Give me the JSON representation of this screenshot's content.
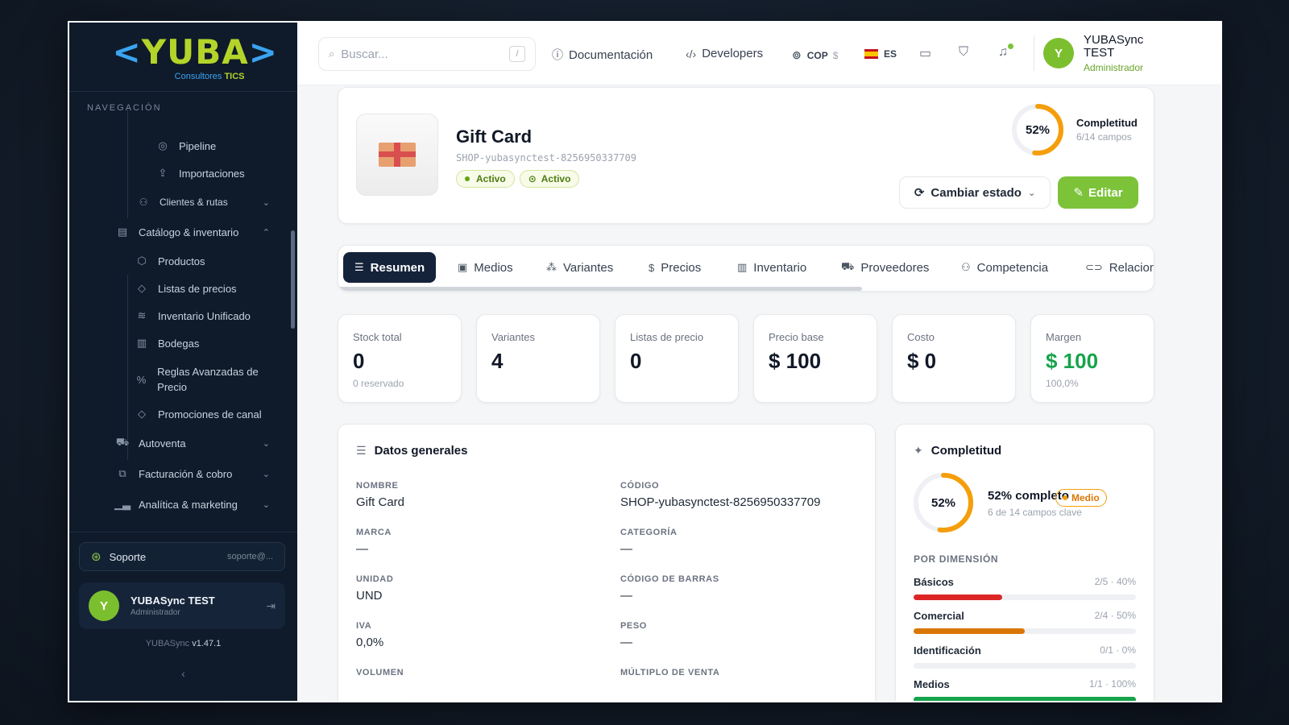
{
  "sidebar": {
    "logo": {
      "brand_left": "<",
      "brand_main": "YUBA",
      "brand_right": ">",
      "sub": "Consultores",
      "sub_bold": "TICS"
    },
    "nav_label": "NAVEGACIÓN",
    "items": [
      {
        "label": "Pipeline",
        "icon": "target-icon"
      },
      {
        "label": "Importaciones",
        "icon": "upload-icon"
      },
      {
        "label": "Clientes & rutas",
        "icon": "users-icon"
      },
      {
        "label": "Catálogo & inventario",
        "icon": "clipboard-icon"
      },
      {
        "label": "Productos",
        "icon": "cube-icon"
      },
      {
        "label": "Listas de precios",
        "icon": "tag-icon"
      },
      {
        "label": "Inventario Unificado",
        "icon": "layers-icon"
      },
      {
        "label": "Bodegas",
        "icon": "warehouse-icon"
      },
      {
        "label": "Reglas Avanzadas de Precio",
        "icon": "percent-icon"
      },
      {
        "label": "Promociones de canal",
        "icon": "tag-icon"
      },
      {
        "label": "Autoventa",
        "icon": "truck-icon"
      },
      {
        "label": "Facturación & cobro",
        "icon": "receipt-icon"
      },
      {
        "label": "Analítica & marketing",
        "icon": "chart-icon"
      }
    ],
    "support": {
      "label": "Soporte",
      "email": "soporte@..."
    },
    "user": {
      "initial": "Y",
      "name": "YUBASync TEST",
      "role": "Administrador"
    },
    "version_prefix": "YUBASync",
    "version": "v1.47.1"
  },
  "topbar": {
    "search": {
      "placeholder": "Buscar...",
      "shortcut": "/"
    },
    "docs": "Documentación",
    "developers": "Developers",
    "currency": "COP",
    "currency_symbol": "$",
    "language": "ES",
    "user": {
      "initial": "Y",
      "name": "YUBASync TEST",
      "role": "Administrador"
    }
  },
  "product": {
    "title": "Gift Card",
    "code": "SHOP-yubasynctest-8256950337709",
    "badges": [
      "Activo",
      "Activo"
    ],
    "completion": {
      "percent": 52,
      "percent_label": "52%",
      "label": "Completitud",
      "sub": "6/14 campos"
    },
    "change_state": "Cambiar estado",
    "edit": "Editar"
  },
  "tabs": [
    {
      "label": "Resumen",
      "icon": "checklist-icon",
      "active": true
    },
    {
      "label": "Medios",
      "icon": "image-icon"
    },
    {
      "label": "Variantes",
      "icon": "variants-icon"
    },
    {
      "label": "Precios",
      "icon": "dollar-icon"
    },
    {
      "label": "Inventario",
      "icon": "inventory-icon"
    },
    {
      "label": "Proveedores",
      "icon": "truck-icon"
    },
    {
      "label": "Competencia",
      "icon": "users-icon"
    },
    {
      "label": "Relaciona",
      "icon": "link-icon"
    }
  ],
  "stats": [
    {
      "label": "Stock total",
      "value": "0",
      "sub": "0 reservado"
    },
    {
      "label": "Variantes",
      "value": "4",
      "sub": ""
    },
    {
      "label": "Listas de precio",
      "value": "0",
      "sub": ""
    },
    {
      "label": "Precio base",
      "value": "$ 100",
      "sub": ""
    },
    {
      "label": "Costo",
      "value": "$ 0",
      "sub": ""
    },
    {
      "label": "Margen",
      "value": "$ 100",
      "sub": "100,0%"
    }
  ],
  "general": {
    "title": "Datos generales",
    "fields": [
      {
        "key": "NOMBRE",
        "value": "Gift Card"
      },
      {
        "key": "CÓDIGO",
        "value": "SHOP-yubasynctest-8256950337709"
      },
      {
        "key": "MARCA",
        "value": "—"
      },
      {
        "key": "CATEGORÍA",
        "value": "—"
      },
      {
        "key": "UNIDAD",
        "value": "UND"
      },
      {
        "key": "CÓDIGO DE BARRAS",
        "value": "—"
      },
      {
        "key": "IVA",
        "value": "0,0%"
      },
      {
        "key": "PESO",
        "value": "—"
      },
      {
        "key": "VOLUMEN",
        "value": ""
      },
      {
        "key": "MÚLTIPLO DE VENTA",
        "value": ""
      }
    ]
  },
  "completeness": {
    "title": "Completitud",
    "percent": 52,
    "percent_label": "52%",
    "headline": "52% completo",
    "level": "Medio",
    "sub": "6 de 14 campos clave",
    "dim_header": "POR DIMENSIÓN",
    "dimensions": [
      {
        "name": "Básicos",
        "value": "2/5 · 40%",
        "fraction": 0.4,
        "color": "#dc2626"
      },
      {
        "name": "Comercial",
        "value": "2/4 · 50%",
        "fraction": 0.5,
        "color": "#d97706"
      },
      {
        "name": "Identificación",
        "value": "0/1 · 0%",
        "fraction": 0,
        "color": "#16a34a"
      },
      {
        "name": "Medios",
        "value": "1/1 · 100%",
        "fraction": 1,
        "color": "#16a34a"
      }
    ]
  },
  "colors": {
    "accent": "#7cc33a",
    "ring": "#f59e0b",
    "sidebar": "#0f1b2b",
    "active_tab": "#14233a"
  }
}
